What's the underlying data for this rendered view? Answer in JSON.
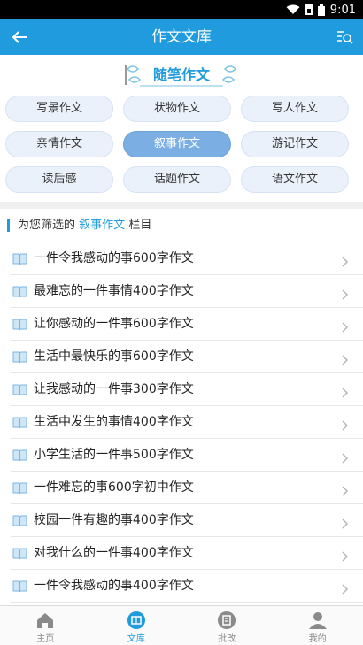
{
  "status_bar": {
    "time": "9:01"
  },
  "app_bar": {
    "title": "作文文库",
    "back_icon": "arrow-left-icon",
    "search_icon": "search-list-icon"
  },
  "section": {
    "banner_title": "随笔作文"
  },
  "categories": [
    {
      "label": "写景作文",
      "active": false
    },
    {
      "label": "状物作文",
      "active": false
    },
    {
      "label": "写人作文",
      "active": false
    },
    {
      "label": "亲情作文",
      "active": false
    },
    {
      "label": "叙事作文",
      "active": true
    },
    {
      "label": "游记作文",
      "active": false
    },
    {
      "label": "读后感",
      "active": false
    },
    {
      "label": "话题作文",
      "active": false
    },
    {
      "label": "语文作文",
      "active": false
    }
  ],
  "filter": {
    "prefix": "为您筛选的",
    "category": "叙事作文",
    "suffix": "栏目"
  },
  "articles": [
    "一件令我感动的事600字作文",
    "最难忘的一件事情400字作文",
    "让你感动的一件事600字作文",
    "生活中最快乐的事600字作文",
    "让我感动的一件事300字作文",
    "生活中发生的事情400字作文",
    "小学生活的一件事500字作文",
    "一件难忘的事600字初中作文",
    "校园一件有趣的事400字作文",
    "对我什么的一件事400字作文",
    "一件令我感动的事400字作文"
  ],
  "tabs": [
    {
      "label": "主页",
      "icon": "home-icon",
      "active": false
    },
    {
      "label": "文库",
      "icon": "library-icon",
      "active": true
    },
    {
      "label": "批改",
      "icon": "review-icon",
      "active": false
    },
    {
      "label": "我的",
      "icon": "profile-icon",
      "active": false
    }
  ],
  "colors": {
    "primary": "#1f9bde",
    "chip_bg": "#eaf1fb",
    "chip_active": "#7baee3"
  }
}
